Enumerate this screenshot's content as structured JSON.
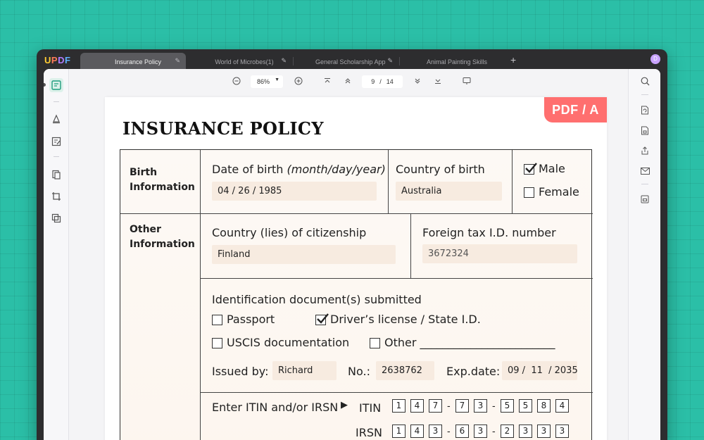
{
  "app": {
    "logo": [
      "U",
      "P",
      "D",
      "F"
    ],
    "avatar_initial": "D"
  },
  "tabs": [
    {
      "label": "Insurance Policy",
      "active": true
    },
    {
      "label": "World of Microbes(1)",
      "active": false
    },
    {
      "label": "General Scholarship Application",
      "active": false
    },
    {
      "label": "Animal Painting Skills",
      "active": false
    }
  ],
  "toolbar": {
    "zoom": "86%",
    "current_page": "9",
    "page_separator": "/",
    "total_pages": "14"
  },
  "document": {
    "badge": "PDF / A",
    "title": "INSURANCE POLICY",
    "birth_section": {
      "label_line1": "Birth",
      "label_line2": "Information",
      "dob_label": "Date of birth ",
      "dob_hint": "(month/day/year)",
      "dob_value": "04 / 26 / 1985",
      "country_label": "Country of birth",
      "country_value": "Australia",
      "male_label": "Male",
      "female_label": "Female",
      "male_checked": true,
      "female_checked": false
    },
    "other_section": {
      "label_line1": "Other",
      "label_line2": "Information",
      "citizenship_label": "Country (lies) of citizenship",
      "citizenship_value": "Finland",
      "tax_label": "Foreign tax I.D. number",
      "tax_value": "3672324",
      "id_docs_label": "Identification document(s) submitted",
      "passport_label": "Passport",
      "drivers_label": "Driver’s license / State I.D.",
      "uscis_label": "USCIS documentation",
      "other_label": "Other ________________________",
      "passport_checked": false,
      "drivers_checked": true,
      "uscis_checked": false,
      "other_checked": false,
      "issued_by_label": "Issued by:",
      "issued_by_value": "Richard",
      "no_label": "No.:",
      "no_value": "2638762",
      "exp_label": "Exp.date:",
      "exp_value": "09 /  11  / 2035",
      "itin_prompt": "Enter ITIN and/or IRSN",
      "itin_label": "ITIN",
      "irsn_label": "IRSN",
      "itin_digits": [
        "1",
        "4",
        "7",
        "7",
        "3",
        "5",
        "5",
        "8",
        "4"
      ],
      "irsn_digits": [
        "1",
        "4",
        "3",
        "6",
        "3",
        "2",
        "3",
        "3",
        "3"
      ],
      "dash": "-"
    }
  },
  "colors": {
    "background": "#2bbfa7",
    "badge": "#ff6f6f",
    "field_fill": "#f7ebe0",
    "accent": "#1fae8c"
  }
}
